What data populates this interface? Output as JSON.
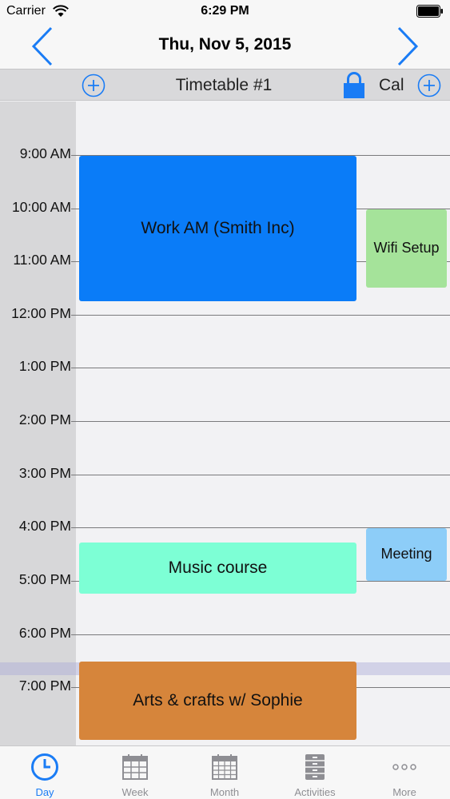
{
  "status": {
    "carrier": "Carrier",
    "time": "6:29 PM"
  },
  "nav": {
    "title": "Thu, Nov 5, 2015"
  },
  "toolbar": {
    "timetable": "Timetable #1",
    "calendar": "Cal"
  },
  "hours": [
    "9:00 AM",
    "10:00 AM",
    "11:00 AM",
    "12:00 PM",
    "1:00 PM",
    "2:00 PM",
    "3:00 PM",
    "4:00 PM",
    "5:00 PM",
    "6:00 PM",
    "7:00 PM"
  ],
  "events": {
    "work": "Work AM (Smith Inc)",
    "wifi": "Wifi Setup",
    "meeting": "Meeting",
    "music": "Music course",
    "arts": "Arts & crafts w/ Sophie"
  },
  "tabs": [
    {
      "label": "Day",
      "icon": "clock-icon"
    },
    {
      "label": "Week",
      "icon": "calendar-week-icon"
    },
    {
      "label": "Month",
      "icon": "calendar-month-icon"
    },
    {
      "label": "Activities",
      "icon": "cabinet-icon"
    },
    {
      "label": "More",
      "icon": "more-dots-icon"
    }
  ],
  "colors": {
    "accent": "#1a7cf5",
    "work": "#0a7cf8",
    "wifi": "#a5e39a",
    "meeting": "#8dcdf8",
    "music": "#7dffd5",
    "arts": "#d6853b"
  }
}
